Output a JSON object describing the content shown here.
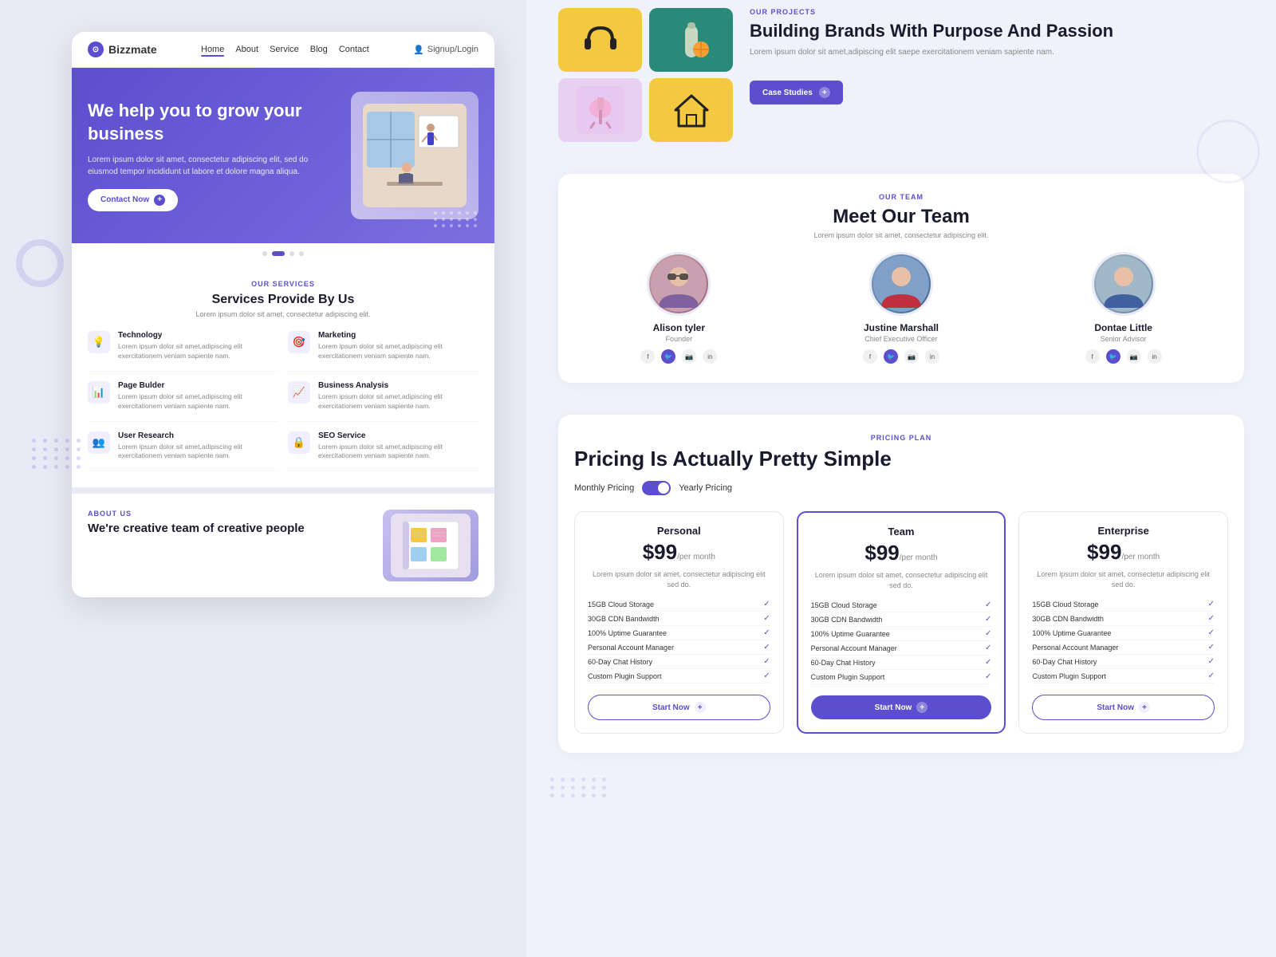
{
  "nav": {
    "logo": "Bizzmate",
    "links": [
      "Home",
      "About",
      "Service",
      "Blog",
      "Contact"
    ],
    "active_link": "Home",
    "signup": "Signup/Login"
  },
  "hero": {
    "title": "We help you to grow your business",
    "description": "Lorem ipsum dolor sit amet, consectetur adipiscing elit, sed do eiusmod tempor incididunt ut labore et dolore magna aliqua.",
    "cta_label": "Contact Now"
  },
  "services": {
    "label": "OUR SERVICES",
    "title": "Services Provide By Us",
    "description": "Lorem ipsum dolor sit amet, consectetur adipiscing elit.",
    "items": [
      {
        "icon": "💡",
        "name": "Technology",
        "desc": "Lorem ipsum dolor sit amet,adipiscing elit exercitationem veniam sapiente nam."
      },
      {
        "icon": "🎯",
        "name": "Marketing",
        "desc": "Lorem ipsum dolor sit amet,adipiscing elit exercitationem veniam sapiente nam."
      },
      {
        "icon": "📊",
        "name": "Page Bulder",
        "desc": "Lorem ipsum dolor sit amet,adipiscing elit exercitationem veniam sapiente nam."
      },
      {
        "icon": "📈",
        "name": "Business Analysis",
        "desc": "Lorem ipsum dolor sit amet,adipiscing elit exercitationem veniam sapiente nam."
      },
      {
        "icon": "👥",
        "name": "User Research",
        "desc": "Lorem ipsum dolor sit amet,adipiscing elit exercitationem veniam sapiente nam."
      },
      {
        "icon": "🔒",
        "name": "SEO Service",
        "desc": "Lorem ipsum dolor sit amet,adipiscing elit exercitationem veniam sapiente nam."
      }
    ]
  },
  "about": {
    "label": "ABOUT US",
    "title": "We're creative team of creative people"
  },
  "projects": {
    "label": "OUR PROJECTS",
    "title": "Building Brands With Purpose And Passion",
    "description": "Lorem ipsum dolor sit amet,adipiscing elit saepe exercitationem veniam sapiente nam.",
    "cta_label": "Case Studies"
  },
  "team": {
    "label": "OUR TEAM",
    "title": "Meet Our Team",
    "description": "Lorem ipsum dolor sit amet, consectetur adipiscing elit.",
    "members": [
      {
        "name": "Alison tyler",
        "role": "Founder"
      },
      {
        "name": "Justine Marshall",
        "role": "Chief Executive Officer"
      },
      {
        "name": "Dontae Little",
        "role": "Senior Advisor"
      }
    ]
  },
  "pricing": {
    "label": "PRICING PLAN",
    "title": "Pricing Is Actually Pretty Simple",
    "toggle_left": "Monthly Pricing",
    "toggle_right": "Yearly Pricing",
    "plans": [
      {
        "name": "Personal",
        "price": "$99",
        "period": "/per month",
        "desc": "Lorem ipsum dolor sit amet, consectetur adipiscing elit sed do.",
        "featured": false,
        "features": [
          "15GB Cloud Storage",
          "30GB CDN Bandwidth",
          "100% Uptime Guarantee",
          "Personal Account Manager",
          "60-Day Chat History",
          "Custom Plugin Support"
        ],
        "cta": "Start Now"
      },
      {
        "name": "Team",
        "price": "$99",
        "period": "/per month",
        "desc": "Lorem ipsum dolor sit amet, consectetur adipiscing elit sed do.",
        "featured": true,
        "features": [
          "15GB Cloud Storage",
          "30GB CDN Bandwidth",
          "100% Uptime Guarantee",
          "Personal Account Manager",
          "60-Day Chat History",
          "Custom Plugin Support"
        ],
        "cta": "Start Now"
      },
      {
        "name": "Enterprise",
        "price": "$99",
        "period": "/per month",
        "desc": "Lorem ipsum dolor sit amet, consectetur adipiscing elit sed do.",
        "featured": false,
        "features": [
          "15GB Cloud Storage",
          "30GB CDN Bandwidth",
          "100% Uptime Guarantee",
          "Personal Account Manager",
          "60-Day Chat History",
          "Custom Plugin Support"
        ],
        "cta": "Start Now"
      }
    ]
  }
}
